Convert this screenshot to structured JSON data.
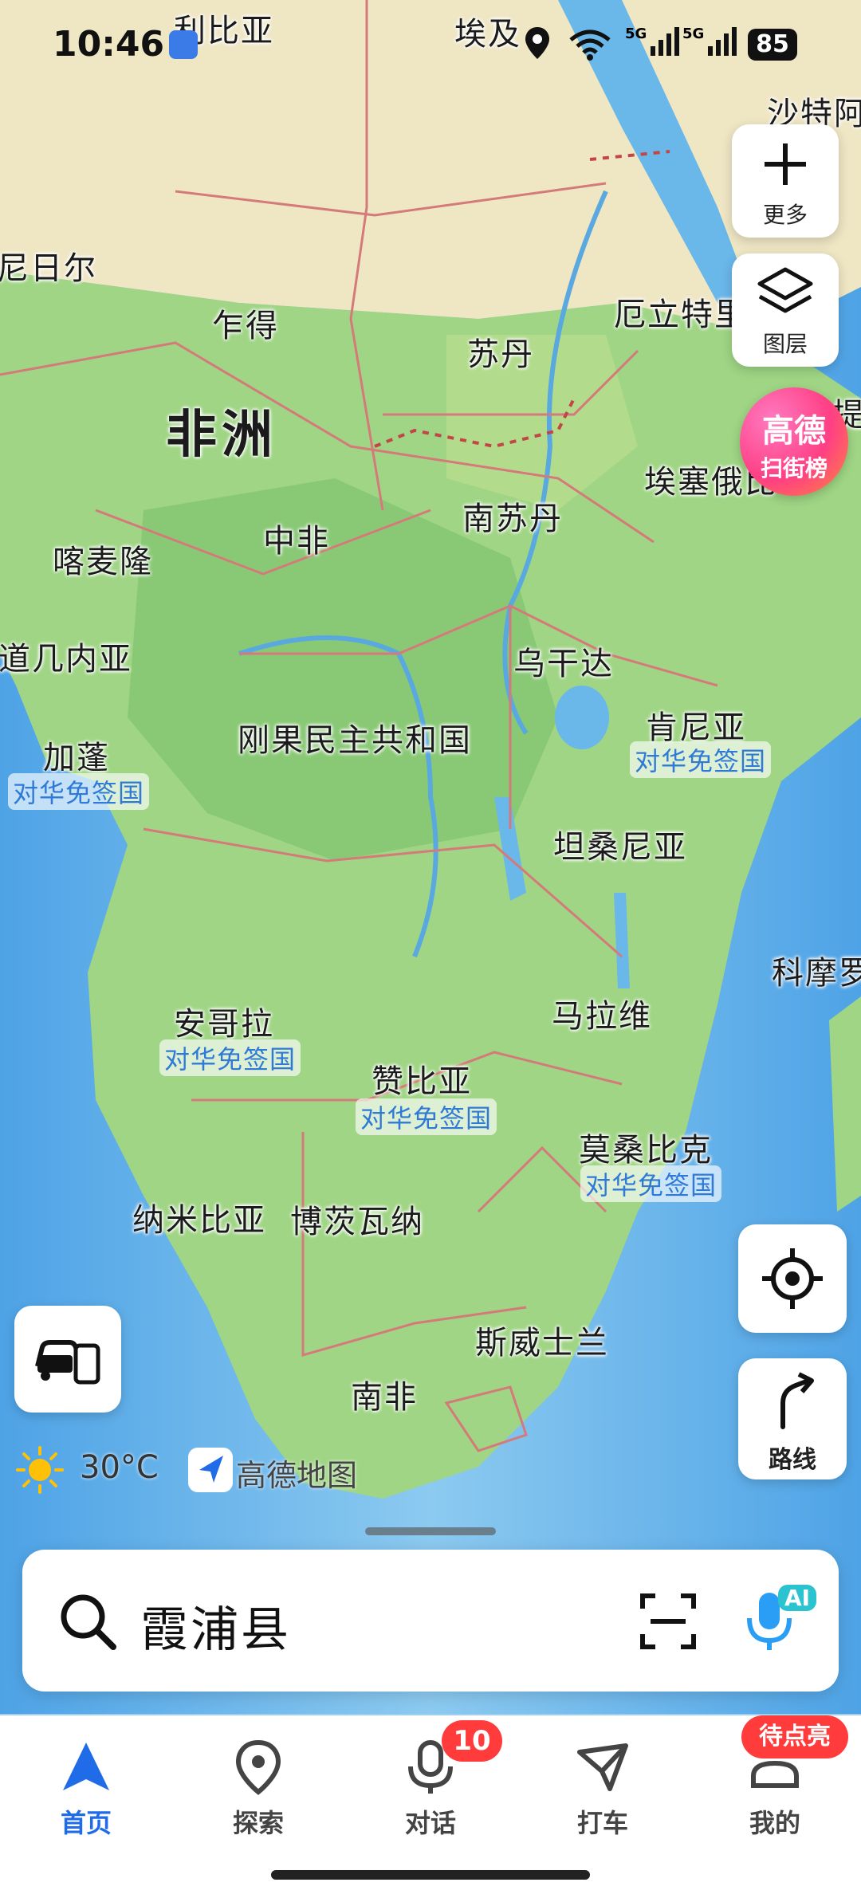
{
  "status": {
    "time": "10:46",
    "network1": "5G",
    "network2": "5G",
    "battery": "85"
  },
  "map": {
    "continent": "非洲",
    "countries": [
      {
        "name": "利比亚"
      },
      {
        "name": "埃及"
      },
      {
        "name": "沙特阿"
      },
      {
        "name": "尼日尔"
      },
      {
        "name": "乍得"
      },
      {
        "name": "苏丹"
      },
      {
        "name": "厄立特里"
      },
      {
        "name": "埃塞俄比"
      },
      {
        "name": "中非"
      },
      {
        "name": "南苏丹"
      },
      {
        "name": "喀麦隆"
      },
      {
        "name": "道几内亚"
      },
      {
        "name": "乌干达"
      },
      {
        "name": "肯尼亚"
      },
      {
        "name": "加蓬"
      },
      {
        "name": "刚果民主共和国"
      },
      {
        "name": "坦桑尼亚"
      },
      {
        "name": "科摩罗"
      },
      {
        "name": "马拉维"
      },
      {
        "name": "安哥拉"
      },
      {
        "name": "赞比亚"
      },
      {
        "name": "莫桑比克"
      },
      {
        "name": "纳米比亚"
      },
      {
        "name": "博茨瓦纳"
      },
      {
        "name": "斯威士兰"
      },
      {
        "name": "南非"
      },
      {
        "name": "提"
      }
    ],
    "visa_free_label": "对华免签国"
  },
  "controls": {
    "more_label": "更多",
    "layers_label": "图层",
    "rank_line1": "高德",
    "rank_line2": "扫街榜",
    "route_label": "路线"
  },
  "weather": {
    "temp": "30°C",
    "brand": "高德地图"
  },
  "search": {
    "query": "霞浦县",
    "ai_badge": "AI"
  },
  "tabs": [
    {
      "label": "首页",
      "icon": "navigation-arrow-icon"
    },
    {
      "label": "探索",
      "icon": "location-pin-icon"
    },
    {
      "label": "对话",
      "icon": "microphone-icon",
      "badge": "10"
    },
    {
      "label": "打车",
      "icon": "taxi-icon"
    },
    {
      "label": "我的",
      "icon": "profile-icon",
      "badge": "待点亮"
    }
  ],
  "colors": {
    "accent": "#1f6be8",
    "badge": "#ff3b3b",
    "land": "#a8d98a",
    "ocean": "#7fbde8"
  }
}
